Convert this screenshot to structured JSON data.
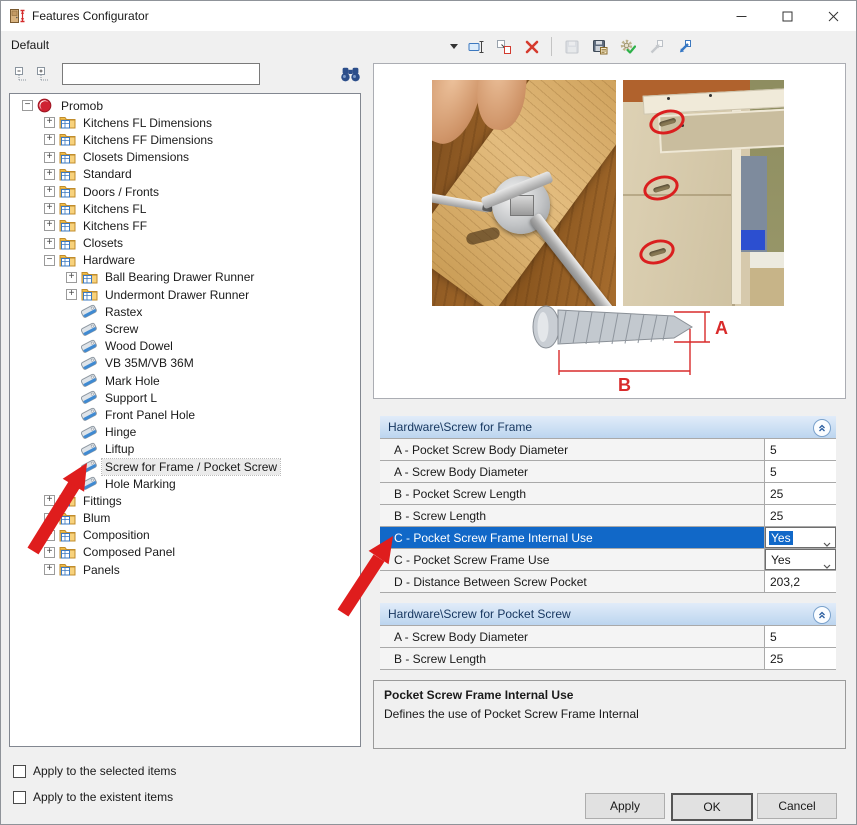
{
  "window": {
    "title": "Features Configurator"
  },
  "toolbar": {
    "profile": "Default",
    "buttons": [
      {
        "name": "rename-profile-icon"
      },
      {
        "name": "duplicate-profile-icon"
      },
      {
        "name": "delete-profile-icon"
      },
      {
        "name": "separator"
      },
      {
        "name": "save-icon",
        "disabled": true
      },
      {
        "name": "save-config-icon"
      },
      {
        "name": "apply-config-icon"
      },
      {
        "name": "import-icon",
        "disabled": true
      },
      {
        "name": "export-icon"
      }
    ]
  },
  "search": {
    "value": "",
    "icons": [
      "collapse-tree-icon",
      "expand-tree-icon",
      "binoculars-icon"
    ]
  },
  "tree": {
    "items": [
      {
        "label": "Promob",
        "depth": 0,
        "expander": "minus",
        "icon": "promob-logo-icon"
      },
      {
        "label": "Kitchens FL Dimensions",
        "depth": 1,
        "expander": "plus",
        "icon": "folder-icon"
      },
      {
        "label": "Kitchens FF Dimensions",
        "depth": 1,
        "expander": "plus",
        "icon": "folder-icon"
      },
      {
        "label": "Closets Dimensions",
        "depth": 1,
        "expander": "plus",
        "icon": "folder-icon"
      },
      {
        "label": "Standard",
        "depth": 1,
        "expander": "plus",
        "icon": "folder-icon"
      },
      {
        "label": "Doors / Fronts",
        "depth": 1,
        "expander": "plus",
        "icon": "folder-icon"
      },
      {
        "label": "Kitchens FL",
        "depth": 1,
        "expander": "plus",
        "icon": "folder-icon"
      },
      {
        "label": "Kitchens FF",
        "depth": 1,
        "expander": "plus",
        "icon": "folder-icon"
      },
      {
        "label": "Closets",
        "depth": 1,
        "expander": "plus",
        "icon": "folder-icon"
      },
      {
        "label": "Hardware",
        "depth": 1,
        "expander": "minus",
        "icon": "folder-icon"
      },
      {
        "label": "Ball Bearing Drawer Runner",
        "depth": 2,
        "expander": "plus",
        "icon": "folder-icon"
      },
      {
        "label": "Undermont Drawer Runner",
        "depth": 2,
        "expander": "plus",
        "icon": "folder-icon"
      },
      {
        "label": "Rastex",
        "depth": 2,
        "expander": "none",
        "icon": "feature-tag-icon"
      },
      {
        "label": "Screw",
        "depth": 2,
        "expander": "none",
        "icon": "feature-tag-icon"
      },
      {
        "label": "Wood Dowel",
        "depth": 2,
        "expander": "none",
        "icon": "feature-tag-icon"
      },
      {
        "label": "VB 35M/VB 36M",
        "depth": 2,
        "expander": "none",
        "icon": "feature-tag-icon"
      },
      {
        "label": "Mark Hole",
        "depth": 2,
        "expander": "none",
        "icon": "feature-tag-icon"
      },
      {
        "label": "Support L",
        "depth": 2,
        "expander": "none",
        "icon": "feature-tag-icon"
      },
      {
        "label": "Front Panel Hole",
        "depth": 2,
        "expander": "none",
        "icon": "feature-tag-icon"
      },
      {
        "label": "Hinge",
        "depth": 2,
        "expander": "none",
        "icon": "feature-tag-icon"
      },
      {
        "label": "Liftup",
        "depth": 2,
        "expander": "none",
        "icon": "feature-tag-icon"
      },
      {
        "label": "Screw for Frame / Pocket Screw",
        "depth": 2,
        "expander": "none",
        "icon": "feature-tag-icon",
        "selected": true
      },
      {
        "label": "Hole Marking",
        "depth": 2,
        "expander": "none",
        "icon": "feature-tag-icon"
      },
      {
        "label": "Fittings",
        "depth": 1,
        "expander": "plus",
        "icon": "folder-icon"
      },
      {
        "label": "Blum",
        "depth": 1,
        "expander": "plus",
        "icon": "folder-icon"
      },
      {
        "label": "Composition",
        "depth": 1,
        "expander": "plus",
        "icon": "folder-icon"
      },
      {
        "label": "Composed Panel",
        "depth": 1,
        "expander": "plus",
        "icon": "folder-icon"
      },
      {
        "label": "Panels",
        "depth": 1,
        "expander": "plus",
        "icon": "folder-icon"
      }
    ]
  },
  "grid": {
    "groups": [
      {
        "title": "Hardware\\Screw for Frame",
        "rows": [
          {
            "label": "A - Pocket Screw Body Diameter",
            "value": "5",
            "type": "text"
          },
          {
            "label": "A - Screw Body Diameter",
            "value": "5",
            "type": "text"
          },
          {
            "label": "B - Pocket Screw Length",
            "value": "25",
            "type": "text"
          },
          {
            "label": "B - Screw Length",
            "value": "25",
            "type": "text"
          },
          {
            "label": "C - Pocket Screw Frame Internal Use",
            "value": "Yes",
            "type": "dropdown",
            "selected": true
          },
          {
            "label": "C - Pocket Screw Frame Use",
            "value": "Yes",
            "type": "dropdown"
          },
          {
            "label": "D - Distance Between Screw Pocket",
            "value": "203,2",
            "type": "text"
          }
        ]
      },
      {
        "title": "Hardware\\Screw for Pocket Screw",
        "rows": [
          {
            "label": "A - Screw Body Diameter",
            "value": "5",
            "type": "text"
          },
          {
            "label": "B - Screw Length",
            "value": "25",
            "type": "text"
          }
        ]
      }
    ]
  },
  "diagram": {
    "label_a": "A",
    "label_b": "B",
    "accent": "#d92b2b"
  },
  "description": {
    "title": "Pocket Screw Frame Internal Use",
    "text": "Defines the use of Pocket Screw Frame Internal"
  },
  "footer": {
    "checkboxes": [
      {
        "label": "Apply to the selected items",
        "checked": false
      },
      {
        "label": "Apply to the existent items",
        "checked": false
      }
    ],
    "buttons": [
      {
        "label": "Apply"
      },
      {
        "label": "OK",
        "default": true
      },
      {
        "label": "Cancel"
      }
    ]
  },
  "annotations": {
    "arrow_color": "#df1d1d"
  }
}
